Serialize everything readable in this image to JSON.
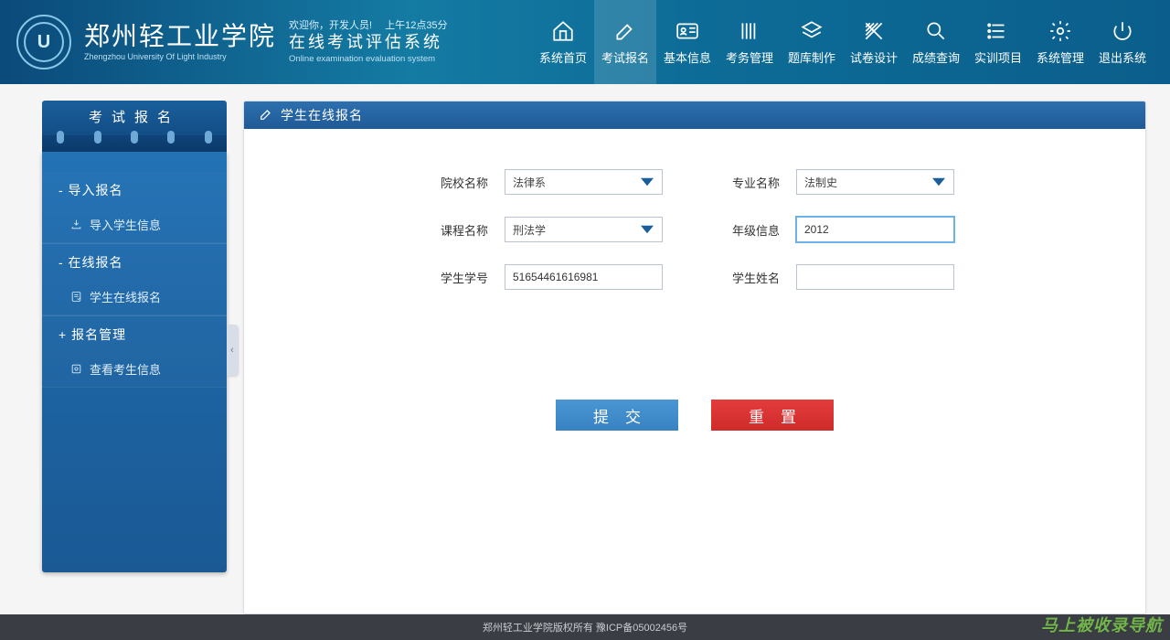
{
  "header": {
    "welcome": "欢迎你，开发人员!",
    "time": "上午12点35分",
    "brand_zh": "郑州轻工业学院",
    "brand_en": "Zhengzhou University Of Light Industry",
    "system_zh": "在线考试评估系统",
    "system_en": "Online examination evaluation system",
    "logo_letter": "U"
  },
  "nav": {
    "items": [
      {
        "label": "系统首页",
        "icon": "home"
      },
      {
        "label": "考试报名",
        "icon": "edit",
        "active": true
      },
      {
        "label": "基本信息",
        "icon": "id-card"
      },
      {
        "label": "考务管理",
        "icon": "books"
      },
      {
        "label": "题库制作",
        "icon": "layers"
      },
      {
        "label": "试卷设计",
        "icon": "ruler"
      },
      {
        "label": "成绩查询",
        "icon": "search"
      },
      {
        "label": "实训项目",
        "icon": "list"
      },
      {
        "label": "系统管理",
        "icon": "gear"
      },
      {
        "label": "退出系统",
        "icon": "power"
      }
    ]
  },
  "sidebar": {
    "title": "考试报名",
    "groups": [
      {
        "header_prefix": "-",
        "header": "导入报名",
        "items": [
          {
            "icon": "import",
            "label": "导入学生信息"
          }
        ]
      },
      {
        "header_prefix": "-",
        "header": "在线报名",
        "items": [
          {
            "icon": "form",
            "label": "学生在线报名"
          }
        ]
      },
      {
        "header_prefix": "+",
        "header": "报名管理",
        "items": [
          {
            "icon": "view",
            "label": "查看考生信息"
          }
        ]
      }
    ]
  },
  "panel": {
    "title": "学生在线报名"
  },
  "form": {
    "school_label": "院校名称",
    "school_value": "法律系",
    "major_label": "专业名称",
    "major_value": "法制史",
    "course_label": "课程名称",
    "course_value": "刑法学",
    "grade_label": "年级信息",
    "grade_value": "2012",
    "sid_label": "学生学号",
    "sid_value": "51654461616981",
    "name_label": "学生姓名",
    "name_value": ""
  },
  "actions": {
    "submit": "提交",
    "reset": "重置"
  },
  "footer": {
    "text": "郑州轻工业学院版权所有  豫ICP备05002456号"
  },
  "watermark": "马上被收录导航"
}
